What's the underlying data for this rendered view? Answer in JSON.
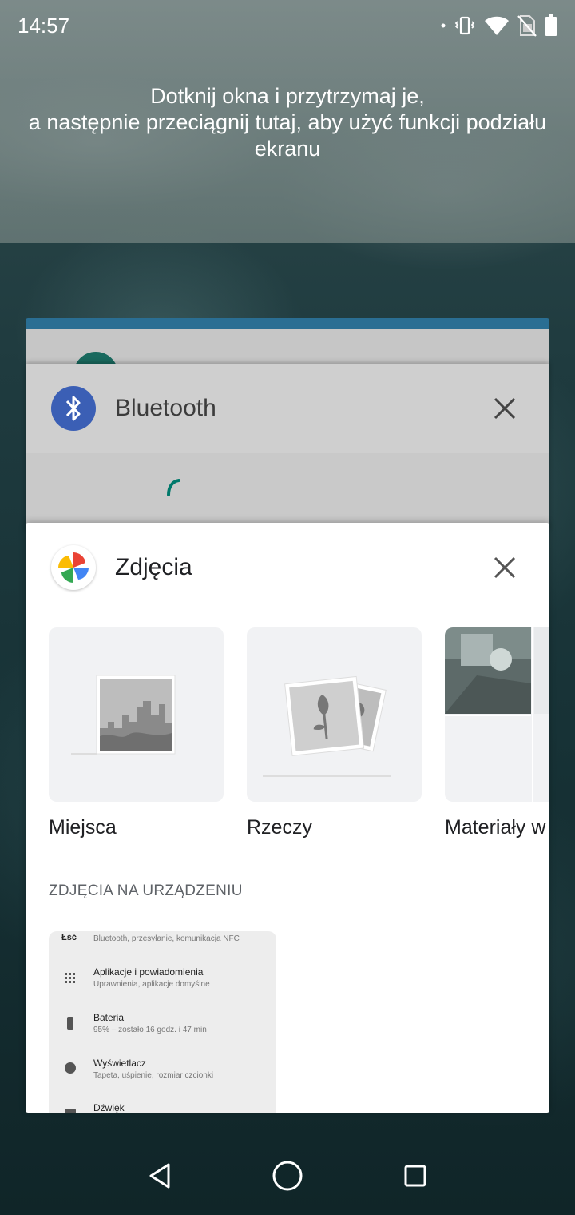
{
  "status_bar": {
    "time": "14:57",
    "icons": [
      "dot-icon",
      "vibrate-icon",
      "wifi-icon",
      "no-sim-icon",
      "battery-icon"
    ]
  },
  "split_screen_hint": {
    "line1": "Dotknij okna i przytrzymaj je,",
    "line2": "a następnie przeciągnij tutaj, aby użyć funkcji podziału",
    "line3": "ekranu"
  },
  "recent_apps": [
    {
      "title": "Bluetooth",
      "icon": "bluetooth-icon",
      "accent": "#3b5fb5"
    },
    {
      "title": "Zdjęcia",
      "icon": "google-photos-icon",
      "tiles": [
        {
          "label": "Miejsca"
        },
        {
          "label": "Rzeczy"
        },
        {
          "label": "Materiały w"
        }
      ],
      "section_label": "ZDJĘCIA NA URZĄDZENIU",
      "thumbnail": {
        "header": "Łść",
        "header_sub": "Bluetooth, przesyłanie, komunikacja NFC",
        "rows": [
          {
            "title": "Aplikacje i powiadomienia",
            "sub": "Uprawnienia, aplikacje domyślne"
          },
          {
            "title": "Bateria",
            "sub": "95% – zostało 16 godz. i 47 min"
          },
          {
            "title": "Wyświetlacz",
            "sub": "Tapeta, uśpienie, rozmiar czcionki"
          },
          {
            "title": "Dźwięk",
            "sub": ""
          }
        ]
      }
    }
  ],
  "nav_bar": {
    "buttons": [
      "back-icon",
      "home-icon",
      "recents-icon"
    ]
  },
  "colors": {
    "header_bar": "#2a6e93",
    "card_bg": "#ffffff",
    "inactive_card_bg": "#cfcfcf",
    "spinner": "#00796b"
  }
}
